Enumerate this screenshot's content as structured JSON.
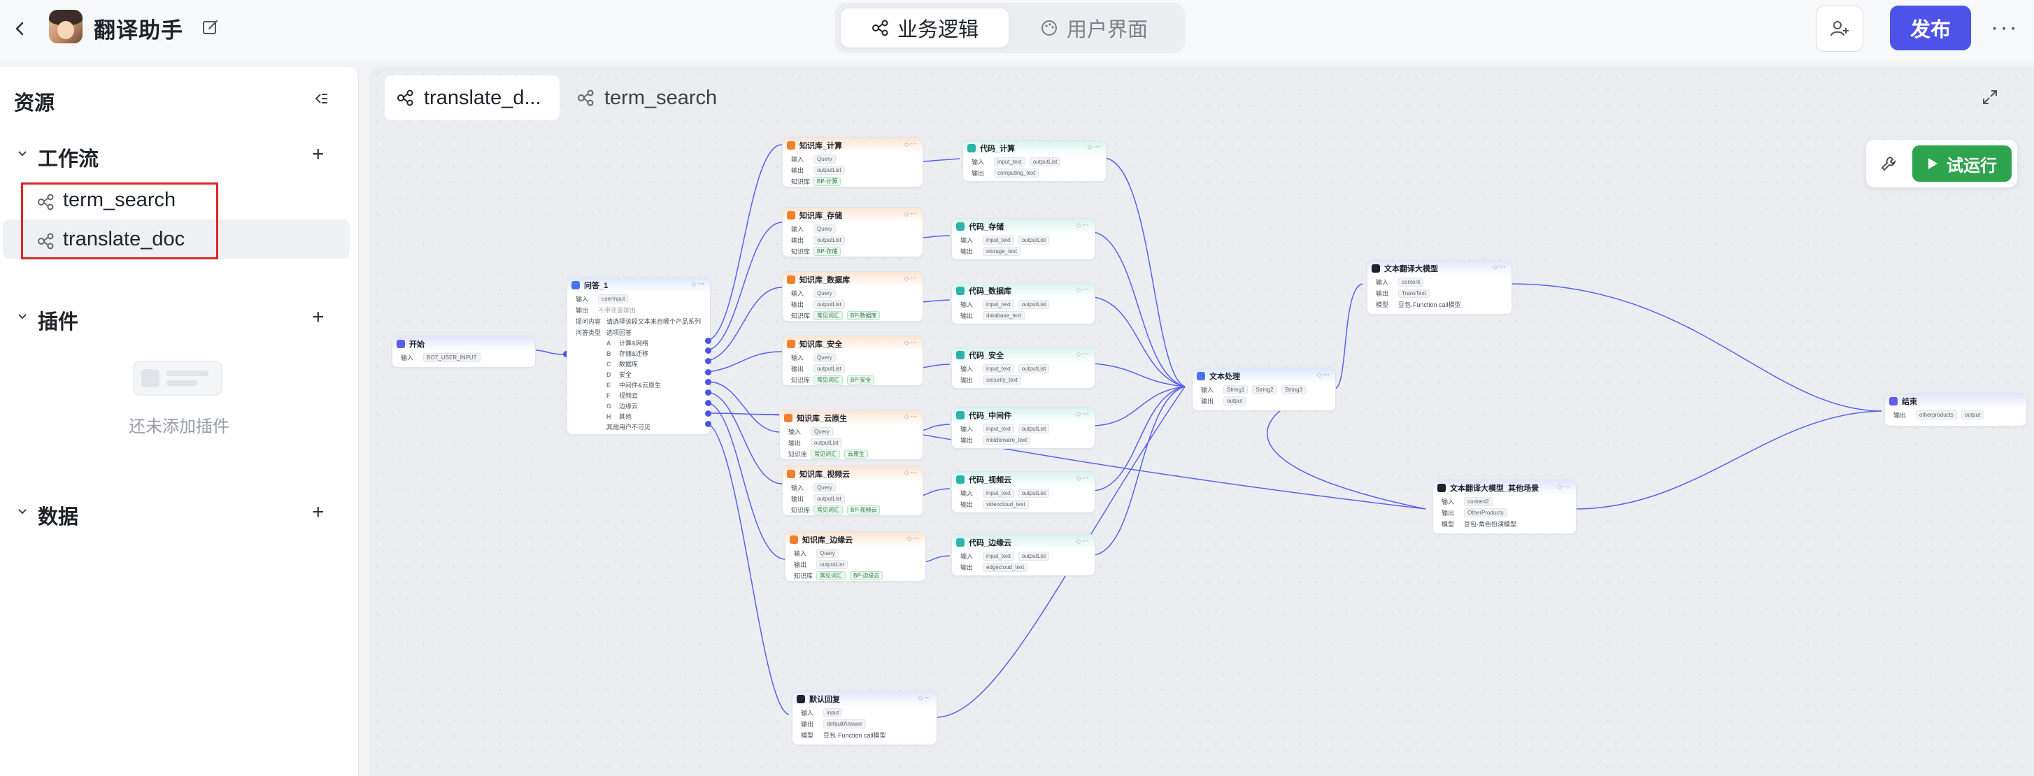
{
  "header": {
    "app_name": "翻译助手",
    "tabs": [
      {
        "label": "业务逻辑",
        "active": true
      },
      {
        "label": "用户界面",
        "active": false
      }
    ],
    "publish_label": "发布",
    "more_label": "···"
  },
  "sidebar": {
    "title": "资源",
    "sections": {
      "workflow": {
        "label": "工作流",
        "items": [
          "term_search",
          "translate_doc"
        ],
        "selected": "translate_doc"
      },
      "plugin": {
        "label": "插件",
        "empty_text": "还未添加插件"
      },
      "data": {
        "label": "数据"
      }
    }
  },
  "canvas": {
    "tabs": [
      {
        "label": "translate_d...",
        "active": true
      },
      {
        "label": "term_search",
        "active": false
      }
    ],
    "run_label": "试运行",
    "colors": {
      "accent": "#4d53e8",
      "run": "#2ea44f",
      "edge": "#4d53e8",
      "highlight": "#e02424"
    }
  },
  "nodes": {
    "start": {
      "title": "开始",
      "in_label": "输入",
      "in_val": "BOT_USER_INPUT"
    },
    "question": {
      "title": "问答_1",
      "in_label": "输入",
      "in_val": "userInput",
      "out_label": "输出",
      "out_val": "不带变量输出",
      "content_label": "提问内容",
      "content_val": "请选择该段文本来自哪个产品系列",
      "type_label": "问答类型",
      "type_val": "选项回答",
      "options": [
        {
          "k": "A",
          "v": "计算&网络"
        },
        {
          "k": "B",
          "v": "存储&迁移"
        },
        {
          "k": "C",
          "v": "数据库"
        },
        {
          "k": "D",
          "v": "安全"
        },
        {
          "k": "E",
          "v": "中间件&云原生"
        },
        {
          "k": "F",
          "v": "视频云"
        },
        {
          "k": "G",
          "v": "边缘云"
        },
        {
          "k": "H",
          "v": "其他"
        },
        {
          "k": "其他",
          "v": "用户不可见"
        }
      ]
    },
    "kb_compute": {
      "title": "知识库_计算",
      "in": "输入",
      "in_v": "Query",
      "out": "输出",
      "out_v": "outputList",
      "kb": "知识库",
      "kb_v": [
        "BP-计算"
      ]
    },
    "kb_storage": {
      "title": "知识库_存储",
      "in": "输入",
      "in_v": "Query",
      "out": "输出",
      "out_v": "outputList",
      "kb": "知识库",
      "kb_v": [
        "BP-存储"
      ]
    },
    "kb_db": {
      "title": "知识库_数据库",
      "in": "输入",
      "in_v": "Query",
      "out": "输出",
      "out_v": "outputList",
      "kb": "知识库",
      "kb_v": [
        "常见词汇",
        "BP-数据库"
      ]
    },
    "kb_sec": {
      "title": "知识库_安全",
      "in": "输入",
      "in_v": "Query",
      "out": "输出",
      "out_v": "outputList",
      "kb": "知识库",
      "kb_v": [
        "常见词汇",
        "BP-安全"
      ]
    },
    "kb_cloudnative": {
      "title": "知识库_云原生",
      "in": "输入",
      "in_v": "Query",
      "out": "输出",
      "out_v": "outputList",
      "kb": "知识库",
      "kb_v": [
        "常见词汇",
        "云原生"
      ]
    },
    "kb_video": {
      "title": "知识库_视频云",
      "in": "输入",
      "in_v": "Query",
      "out": "输出",
      "out_v": "outputList",
      "kb": "知识库",
      "kb_v": [
        "常见词汇",
        "BP-视频云"
      ]
    },
    "kb_edge": {
      "title": "知识库_边缘云",
      "in": "输入",
      "in_v": "Query",
      "out": "输出",
      "out_v": "outputList",
      "kb": "知识库",
      "kb_v": [
        "常见词汇",
        "BP-边缘云"
      ]
    },
    "code_compute": {
      "title": "代码_计算",
      "in": "输入",
      "in_v": [
        "input_text",
        "outputList"
      ],
      "out": "输出",
      "out_v": "computing_text"
    },
    "code_storage": {
      "title": "代码_存储",
      "in": "输入",
      "in_v": [
        "input_text",
        "outputList"
      ],
      "out": "输出",
      "out_v": "storage_text"
    },
    "code_db": {
      "title": "代码_数据库",
      "in": "输入",
      "in_v": [
        "input_text",
        "outputList"
      ],
      "out": "输出",
      "out_v": "database_text"
    },
    "code_sec": {
      "title": "代码_安全",
      "in": "输入",
      "in_v": [
        "input_text",
        "outputList"
      ],
      "out": "输出",
      "out_v": "security_text"
    },
    "code_mw": {
      "title": "代码_中间件",
      "in": "输入",
      "in_v": [
        "input_text",
        "outputList"
      ],
      "out": "输出",
      "out_v": "middleware_text"
    },
    "code_video": {
      "title": "代码_视频云",
      "in": "输入",
      "in_v": [
        "input_text",
        "outputList"
      ],
      "out": "输出",
      "out_v": "videocloud_text"
    },
    "code_edge": {
      "title": "代码_边缘云",
      "in": "输入",
      "in_v": [
        "input_text",
        "outputList"
      ],
      "out": "输出",
      "out_v": "edgecloud_text"
    },
    "default_reply": {
      "title": "默认回复",
      "in": "输入",
      "in_v": "input",
      "out": "输出",
      "out_v": "defaultAnswer",
      "model": "模型",
      "model_v": "豆包·Function call模型"
    },
    "text_proc": {
      "title": "文本处理",
      "in": "输入",
      "in_v": [
        "String1",
        "String2",
        "String3"
      ],
      "out": "输出",
      "out_v": "output"
    },
    "llm_translate": {
      "title": "文本翻译大模型",
      "in": "输入",
      "in_v": "content",
      "out": "输出",
      "out_v": "TransText",
      "model": "模型",
      "model_v": "豆包·Function call模型"
    },
    "llm_other": {
      "title": "文本翻译大模型_其他场景",
      "in": "输入",
      "in_v": "content2",
      "out": "输出",
      "out_v": "OtherProducts",
      "model": "模型",
      "model_v": "豆包·角色扮演模型"
    },
    "end": {
      "title": "结束",
      "out": "输出",
      "out_v": [
        "otherproducts",
        "output"
      ]
    }
  }
}
